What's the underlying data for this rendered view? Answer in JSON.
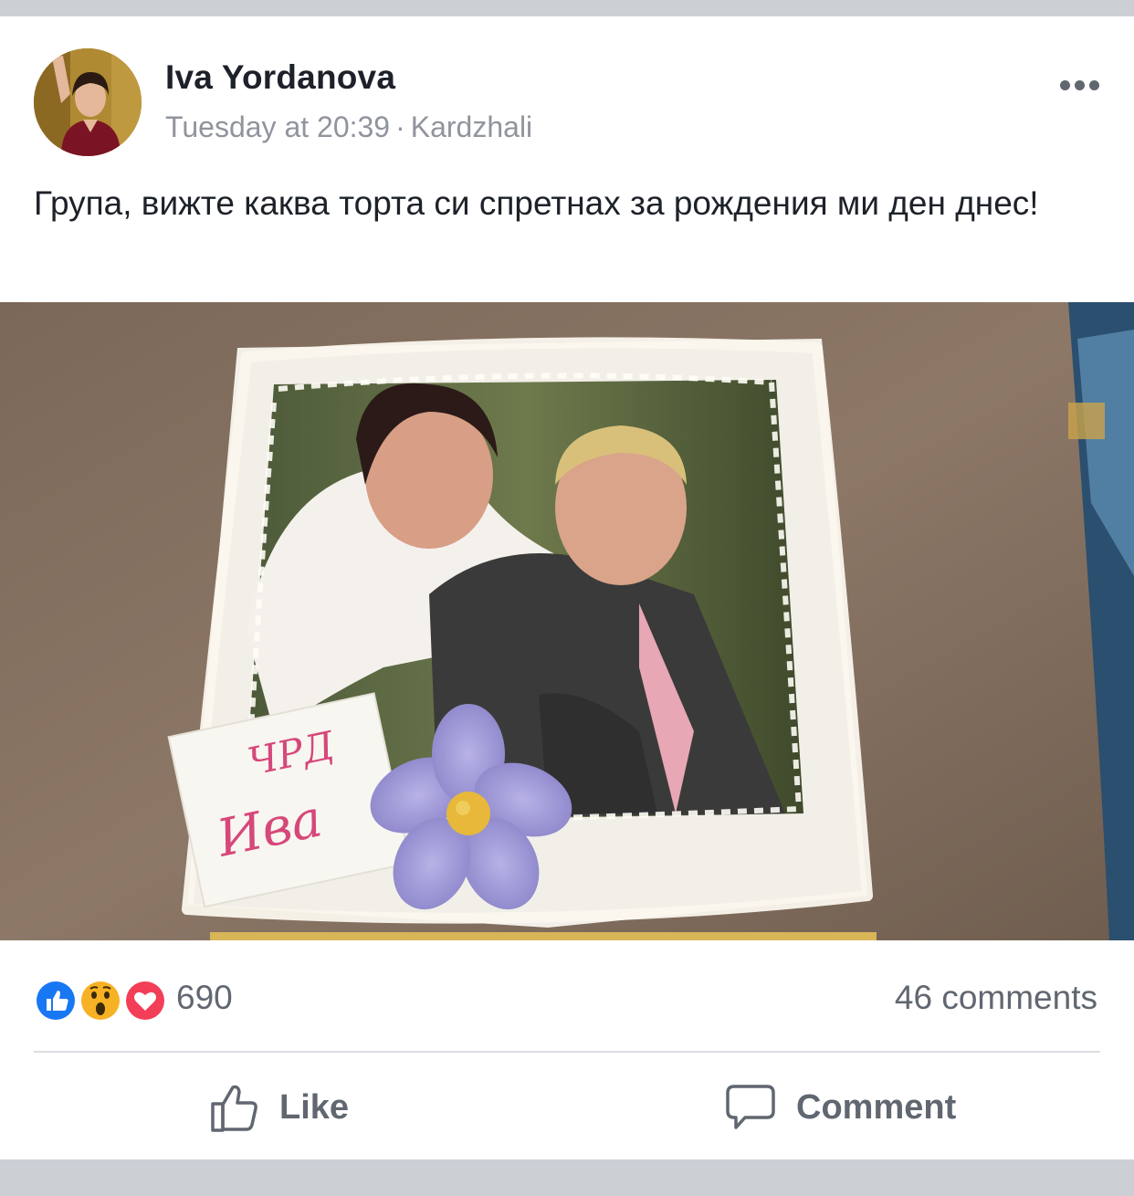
{
  "post": {
    "author": "Iva Yordanova",
    "time": "Tuesday at 20:39",
    "separator": "·",
    "location": "Kardzhali",
    "text": "Група, вижте каква торта си спретнах за рождения ми ден днес!",
    "cake_lettering": [
      "ЧРД",
      "Ива"
    ]
  },
  "reactions": {
    "types": [
      "like-icon",
      "wow-icon",
      "love-icon"
    ],
    "count": "690",
    "comments": "46 comments"
  },
  "actions": {
    "like_label": "Like",
    "comment_label": "Comment"
  },
  "colors": {
    "like_blue": "#1877f2",
    "love_red": "#f33e58",
    "wow_yellow": "#f7b125",
    "text_primary": "#1d2129",
    "text_secondary": "#606770",
    "meta_gray": "#90949c"
  }
}
